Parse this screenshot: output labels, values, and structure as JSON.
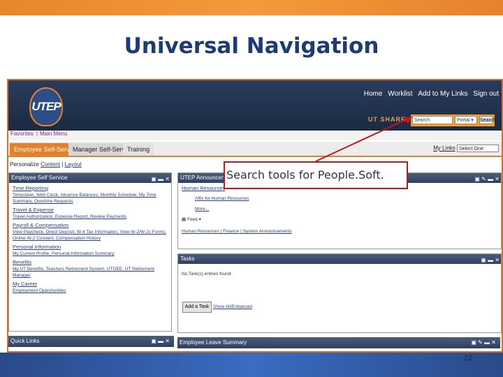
{
  "slide": {
    "title": "Universal Navigation",
    "page_number": "22"
  },
  "callout": {
    "text": "Search tools for People.Soft."
  },
  "header": {
    "logo_text": "UTEP",
    "nav_links": [
      "Home",
      "Worklist",
      "Add to My Links",
      "Sign out"
    ],
    "brand": "UT SHARE",
    "search": {
      "placeholder": "Search",
      "scope": "Portal",
      "button": "Search"
    }
  },
  "menu": {
    "items": [
      "Favorites",
      "Main Menu"
    ]
  },
  "tabs": [
    "Employee Self-Service",
    "Manager Self-Service",
    "Training"
  ],
  "my_links": {
    "label": "My Links",
    "value": "Select One:"
  },
  "personalize": {
    "label": "Personalize",
    "content": "Content",
    "layout": "Layout"
  },
  "left_panel": {
    "title": "Employee Self Service",
    "sections": [
      {
        "heading": "Time Reporting",
        "links": "Timesheet, Web Clock, Absence Balances, Monthly Schedule, My Time Summary, Overtime Requests"
      },
      {
        "heading": "Travel & Expense",
        "links": "Travel Authorization, Expense Report, Review Payments"
      },
      {
        "heading": "Payroll & Compensation",
        "links": "View Paycheck, Direct Deposit, W-4 Tax Information, View W-2/W-2c Forms, Online W-2 Consent, Compensation History"
      },
      {
        "heading": "Personal Information",
        "links": "My Current Profile, Personal Information Summary"
      },
      {
        "heading": "Benefits",
        "links": "My UT Benefits, Teachers Retirement System, UTOEE, UT Retirement Manager"
      },
      {
        "heading": "My Career",
        "links": "Employment Opportunities"
      }
    ]
  },
  "quick_links": {
    "title": "Quick Links"
  },
  "announce_panel": {
    "title": "UTEP Announcements",
    "group": "Human Resources",
    "item": "Affix for Human Resources",
    "more": "More...",
    "feed": "Feed",
    "footer_links": [
      "Human Resources",
      "Finance",
      "System Announcements"
    ]
  },
  "tasks_panel": {
    "title": "Tasks",
    "empty": "No Task(s) entries found",
    "add_button": "Add a Task",
    "show_all": "Show All/Enhanced"
  },
  "leave_panel": {
    "title": "Employee Leave Summary"
  },
  "colors": {
    "accent": "#e4802a",
    "title": "#1f3a78",
    "panel_header": "#2f4060",
    "callout_border": "#c01818"
  }
}
